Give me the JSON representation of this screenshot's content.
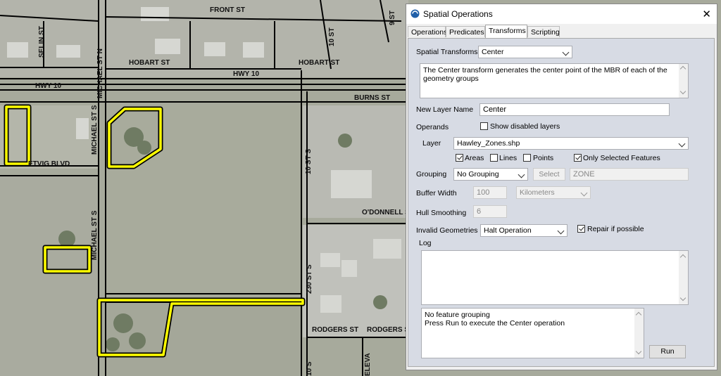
{
  "map": {
    "street_labels": {
      "front_st": "FRONT ST",
      "selin_st": "SELIN ST",
      "hobart_st_west": "HOBART ST",
      "hobart_st_east": "HOBART ST",
      "hwy10_center": "HWY 10",
      "hwy10_west": "HWY 10",
      "michael_st_n": "MICHAEL ST N",
      "st_10_north": "10 ST",
      "st_9": "9 ST",
      "burns_st": "BURNS ST",
      "michael_st_s_upper": "MICHAEL ST S",
      "michael_st_s_lower": "MICHAEL ST S",
      "etvig_blvd": "ETVIG BLVD",
      "st_10_s": "10 ST S",
      "odonnell_st": "O'DONNELL S",
      "st_230_s": "230 ST S",
      "rodgers_st_west": "RODGERS ST",
      "rodgers_st_east": "RODGERS S",
      "st_10_s_bottom": "10 S",
      "elevator": "ELEVA"
    }
  },
  "dialog": {
    "title": "Spatial Operations",
    "close_glyph": "✕",
    "tabs": [
      "Operations",
      "Predicates",
      "Transforms",
      "Scripting"
    ],
    "active_tab": "Transforms",
    "spatial_transforms": {
      "label": "Spatial Transforms",
      "value": "Center"
    },
    "description": "The Center transform generates the center point of the MBR of each of the geometry groups",
    "new_layer_name": {
      "label": "New Layer Name",
      "value": "Center"
    },
    "operands": {
      "label": "Operands",
      "show_disabled_label": "Show disabled layers",
      "show_disabled_checked": false
    },
    "layer": {
      "label": "Layer",
      "value": "Hawley_Zones.shp"
    },
    "filters": [
      {
        "label": "Areas",
        "checked": true
      },
      {
        "label": "Lines",
        "checked": false
      },
      {
        "label": "Points",
        "checked": false
      },
      {
        "label": "Only Selected Features",
        "checked": true
      }
    ],
    "grouping": {
      "label": "Grouping",
      "value": "No Grouping",
      "select_button": "Select",
      "field_value": "ZONE"
    },
    "buffer_width": {
      "label": "Buffer Width",
      "value": "100",
      "units": "Kilometers"
    },
    "hull_smoothing": {
      "label": "Hull Smoothing",
      "value": "6"
    },
    "invalid_geometries": {
      "label": "Invalid Geometries",
      "value": "Halt Operation",
      "repair_label": "Repair if possible",
      "repair_checked": true
    },
    "log": {
      "label": "Log",
      "text": ""
    },
    "status": "No feature grouping\nPress Run to execute the Center operation",
    "run_button": "Run"
  }
}
